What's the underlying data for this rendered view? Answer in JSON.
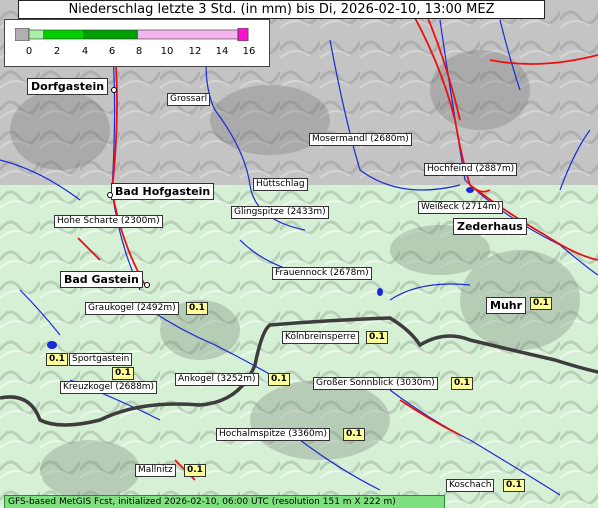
{
  "title": "Niederschlag letzte 3 Std. (in mm) bis Di, 2026-02-10, 13:00 MEZ",
  "legend": {
    "ticks": [
      "0",
      "2",
      "4",
      "6",
      "8",
      "10",
      "12",
      "14",
      "16"
    ],
    "colors": {
      "none": "#b0b0b0",
      "low": "#00c800",
      "mid": "#006e00",
      "high": "#f0a8e8",
      "max": "#ff00cc"
    }
  },
  "places": [
    {
      "id": "dorfgastein",
      "name": "Dorfgastein",
      "big": true
    },
    {
      "id": "grossarl",
      "name": "Grossarl",
      "big": false
    },
    {
      "id": "mosermandl",
      "name": "Mosermandl (2680m)",
      "big": false
    },
    {
      "id": "hochfeind",
      "name": "Hochfeind (2887m)",
      "big": false
    },
    {
      "id": "huettschlag",
      "name": "Hüttschlag",
      "big": false
    },
    {
      "id": "badhofgastein",
      "name": "Bad Hofgastein",
      "big": true
    },
    {
      "id": "glingspitze",
      "name": "Glingspitze (2433m)",
      "big": false
    },
    {
      "id": "weisseck",
      "name": "Weißeck (2714m)",
      "big": false
    },
    {
      "id": "hoheschartе",
      "name": "Hohe Scharte (2300m)",
      "big": false
    },
    {
      "id": "zederhaus",
      "name": "Zederhaus",
      "big": true
    },
    {
      "id": "frauennock",
      "name": "Frauennock (2678m)",
      "big": false
    },
    {
      "id": "badgastein",
      "name": "Bad Gastein",
      "big": true
    },
    {
      "id": "graukogel",
      "name": "Graukogel (2492m)",
      "big": false
    },
    {
      "id": "muhr",
      "name": "Muhr",
      "big": true
    },
    {
      "id": "koelnbreinsperre",
      "name": "Kölnbreinsperre",
      "big": false
    },
    {
      "id": "sportgastein",
      "name": "Sportgastein",
      "big": false
    },
    {
      "id": "kreuzkogel",
      "name": "Kreuzkogel (2688m)",
      "big": false
    },
    {
      "id": "ankogel",
      "name": "Ankogel (3252m)",
      "big": false
    },
    {
      "id": "sonnblick",
      "name": "Großer Sonnblick (3030m)",
      "big": false
    },
    {
      "id": "hochalmspitze",
      "name": "Hochalmspitze (3360m)",
      "big": false
    },
    {
      "id": "mallnitz",
      "name": "Mallnitz",
      "big": false
    },
    {
      "id": "koschach",
      "name": "Koschach",
      "big": false
    }
  ],
  "values": {
    "graukogel": "0.1",
    "muhr": "0.1",
    "koelnbreinsperre": "0.1",
    "sportgastein_left": "0.1",
    "sportgastein": "0.1",
    "ankogel": "0.1",
    "sonnblick": "0.1",
    "hochalmspitze": "0.1",
    "mallnitz": "0.1",
    "koschach": "0.1"
  },
  "footer": "GFS-based MetGIS Fcst, initialized 2026-02-10, 06:00 UTC  (resolution 151 m X 222 m)"
}
